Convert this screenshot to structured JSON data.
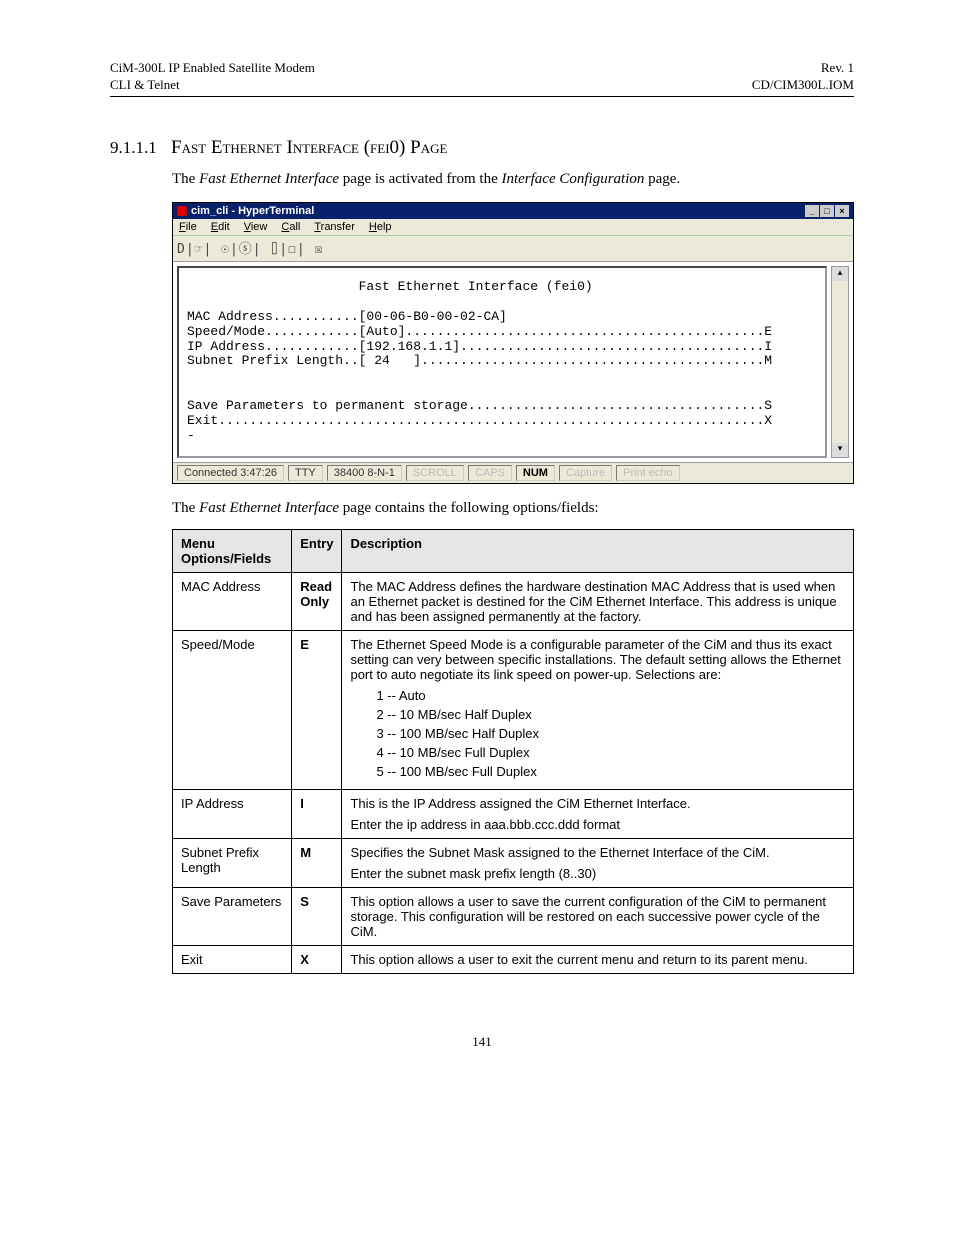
{
  "header": {
    "left_line1": "CiM-300L IP Enabled Satellite Modem",
    "left_line2": "CLI & Telnet",
    "right_line1": "Rev. 1",
    "right_line2": "CD/CIM300L.IOM"
  },
  "section": {
    "number": "9.1.1.1",
    "title_prefix": "F",
    "title_rest": "ast Ethernet Interface (fei0) Page"
  },
  "intro_html": "The <i>Fast Ethernet Interface</i> page is activated from the <i>Interface Configuration</i> page.",
  "terminal": {
    "title": "cim_cli - HyperTerminal",
    "menu": [
      "File",
      "Edit",
      "View",
      "Call",
      "Transfer",
      "Help"
    ],
    "toolbar": "D|☞| ☉|ⓢ| ⌷|☐| ☒",
    "content": "                      Fast Ethernet Interface (fei0)\n\nMAC Address...........[00-06-B0-00-02-CA]\nSpeed/Mode............[Auto]..............................................E\nIP Address............[192.168.1.1].......................................I\nSubnet Prefix Length..[ 24   ]............................................M\n\n\nSave Parameters to permanent storage......................................S\nExit......................................................................X\n-",
    "status": {
      "conn": "Connected 3:47:26",
      "tty": "TTY",
      "baud": "38400 8-N-1",
      "scroll": "SCROLL",
      "caps": "CAPS",
      "num": "NUM",
      "capture": "Capture",
      "echo": "Print echo"
    }
  },
  "post_intro_html": "The <i>Fast Ethernet Interface</i> page contains the following options/fields:",
  "table": {
    "headers": [
      "Menu Options/Fields",
      "Entry",
      "Description"
    ],
    "rows": [
      {
        "name": "MAC Address",
        "entry": "Read Only",
        "desc": [
          "The MAC Address defines the hardware destination MAC Address that is used when an Ethernet packet is destined for the CiM Ethernet Interface. This address is unique and has been assigned permanently at the factory."
        ]
      },
      {
        "name": "Speed/Mode",
        "entry": "E",
        "desc": [
          "The Ethernet Speed Mode is a configurable parameter of the CiM and thus its exact setting can very between specific installations. The default setting allows the Ethernet port to auto negotiate its link speed on power-up. Selections are:"
        ],
        "selections": [
          "1 -- Auto",
          "2 -- 10 MB/sec Half Duplex",
          "3 -- 100 MB/sec Half Duplex",
          "4 -- 10 MB/sec Full Duplex",
          "5 -- 100 MB/sec Full Duplex"
        ]
      },
      {
        "name": "IP Address",
        "entry": "I",
        "desc": [
          "This is the IP Address assigned the CiM Ethernet Interface.",
          "Enter the ip address in aaa.bbb.ccc.ddd format"
        ]
      },
      {
        "name": "Subnet Prefix Length",
        "entry": "M",
        "desc": [
          "Specifies the Subnet Mask assigned to the Ethernet Interface of the CiM.",
          "Enter the subnet mask prefix length (8..30)"
        ]
      },
      {
        "name": "Save Parameters",
        "entry": "S",
        "desc": [
          "This option allows a user to save the current configuration of the CiM to permanent storage. This configuration will be restored on each successive power cycle of the CiM."
        ]
      },
      {
        "name": "Exit",
        "entry": "X",
        "desc": [
          "This option allows a user to exit the current menu and return to its parent menu."
        ]
      }
    ]
  },
  "page_number": "141"
}
